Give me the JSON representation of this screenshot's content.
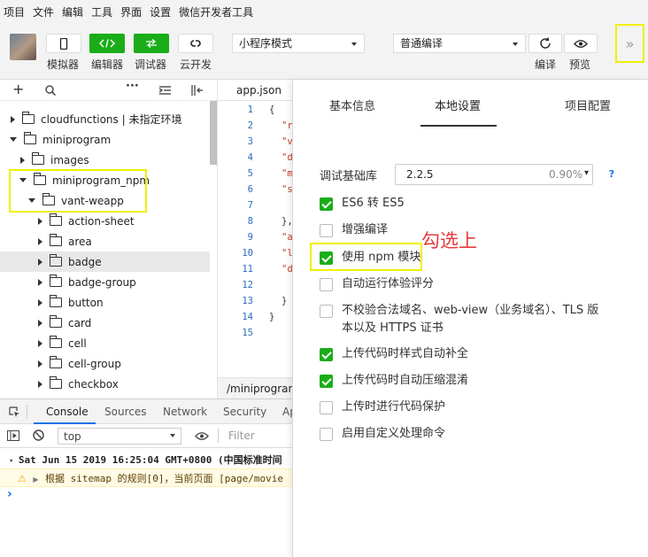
{
  "menu": [
    "项目",
    "文件",
    "编辑",
    "工具",
    "界面",
    "设置",
    "微信开发者工具"
  ],
  "toolbar": {
    "simulator_label": "模拟器",
    "editor_label": "编辑器",
    "debugger_label": "调试器",
    "cloud_label": "云开发",
    "mode_select": "小程序模式",
    "compile_select": "普通编译",
    "compile_label": "编译",
    "preview_label": "预览",
    "more_label": "»"
  },
  "sidebar": {
    "tree": [
      {
        "label": "cloudfunctions | 未指定环境"
      },
      {
        "label": "miniprogram"
      },
      {
        "label": "images"
      },
      {
        "label": "miniprogram_npm"
      },
      {
        "label": "vant-weapp"
      },
      {
        "label": "action-sheet"
      },
      {
        "label": "area"
      },
      {
        "label": "badge"
      },
      {
        "label": "badge-group"
      },
      {
        "label": "button"
      },
      {
        "label": "card"
      },
      {
        "label": "cell"
      },
      {
        "label": "cell-group"
      },
      {
        "label": "checkbox"
      }
    ]
  },
  "editor": {
    "tab": "app.json",
    "line_numbers": [
      "1",
      "2",
      "3",
      "4",
      "5",
      "6",
      "7",
      "8",
      "9",
      "10",
      "11",
      "12",
      "13",
      "14",
      "15"
    ],
    "code_lines": [
      "{",
      "\"r",
      "\"v",
      "\"d",
      "\"m",
      "\"s",
      "",
      "},",
      "\"a",
      "\"l",
      "\"d",
      "",
      "}",
      "}",
      ""
    ],
    "footer_path": "/miniprogram/"
  },
  "devtools": {
    "tabs": [
      "Console",
      "Sources",
      "Network",
      "Security",
      "Ap"
    ],
    "context": "top",
    "filter_placeholder": "Filter",
    "log_time": "Sat Jun 15 2019 16:25:04 GMT+0800 (中国标准时间",
    "log_warn": "根据 sitemap 的规则[0]，当前页面 [page/movie",
    "prompt": "›"
  },
  "panel": {
    "tabs": [
      "基本信息",
      "本地设置",
      "项目配置"
    ],
    "base_lib_label": "调试基础库",
    "base_lib_version": "2.2.5",
    "base_lib_percent": "0.90%",
    "help": "?",
    "options": [
      {
        "label": "ES6 转 ES5",
        "checked": true
      },
      {
        "label": "增强编译",
        "checked": false
      },
      {
        "label": "使用 npm 模块",
        "checked": true
      },
      {
        "label": "自动运行体验评分",
        "checked": false
      },
      {
        "label": "不校验合法域名、web-view（业务域名）、TLS 版本以及 HTTPS 证书",
        "checked": false
      },
      {
        "label": "上传代码时样式自动补全",
        "checked": true
      },
      {
        "label": "上传代码时自动压缩混淆",
        "checked": true
      },
      {
        "label": "上传时进行代码保护",
        "checked": false
      },
      {
        "label": "启用自定义处理命令",
        "checked": false
      }
    ],
    "annotation": "勾选上"
  },
  "colors": {
    "accent_green": "#1aad19",
    "highlight_yellow": "#f0f000",
    "annotation_red": "#e63b3b",
    "link_blue": "#1a73e8"
  }
}
